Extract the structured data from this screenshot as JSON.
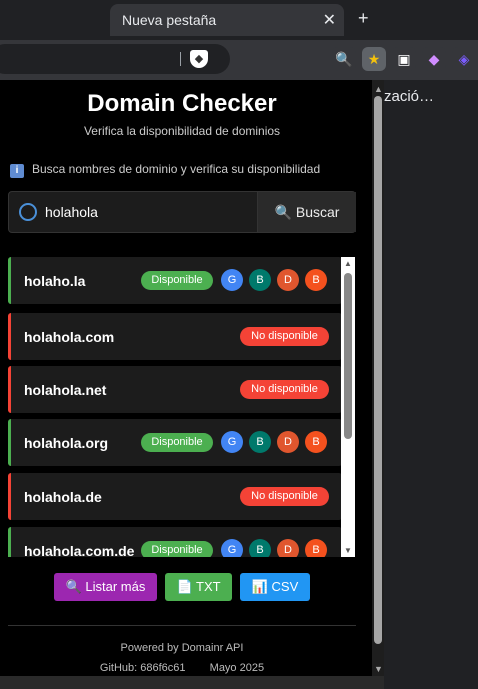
{
  "browser": {
    "tab_title": "Nueva pestaña",
    "close_symbol": "✕",
    "new_tab_symbol": "+",
    "page_text": "zació…"
  },
  "popup": {
    "title": "Domain Checker",
    "subtitle": "Verifica la disponibilidad de dominios",
    "info_text": "Busca nombres de dominio y verifica su disponibilidad",
    "search": {
      "value": "holahola",
      "button_label": "🔍 Buscar"
    },
    "results": [
      {
        "domain": "holaho.la",
        "status": "Disponible",
        "available": true,
        "registrars": [
          "G",
          "B",
          "D",
          "B"
        ]
      },
      {
        "domain": "holahola.com",
        "status": "No disponible",
        "available": false,
        "registrars": []
      },
      {
        "domain": "holahola.net",
        "status": "No disponible",
        "available": false,
        "registrars": []
      },
      {
        "domain": "holahola.org",
        "status": "Disponible",
        "available": true,
        "registrars": [
          "G",
          "B",
          "D",
          "B"
        ]
      },
      {
        "domain": "holahola.de",
        "status": "No disponible",
        "available": false,
        "registrars": []
      },
      {
        "domain": "holahola.com.de",
        "status": "Disponible",
        "available": true,
        "registrars": [
          "G",
          "B",
          "D",
          "B"
        ]
      }
    ],
    "registrar_colors": [
      "#4285f4",
      "#00796b",
      "#e0562e",
      "#f4511e"
    ],
    "actions": {
      "list_more": "🔍 Listar más",
      "txt": "📄 TXT",
      "csv": "📊 CSV"
    },
    "footer": {
      "powered": "Powered by Domainr API",
      "github": "GitHub: 686f6c61",
      "date": "Mayo 2025"
    }
  }
}
